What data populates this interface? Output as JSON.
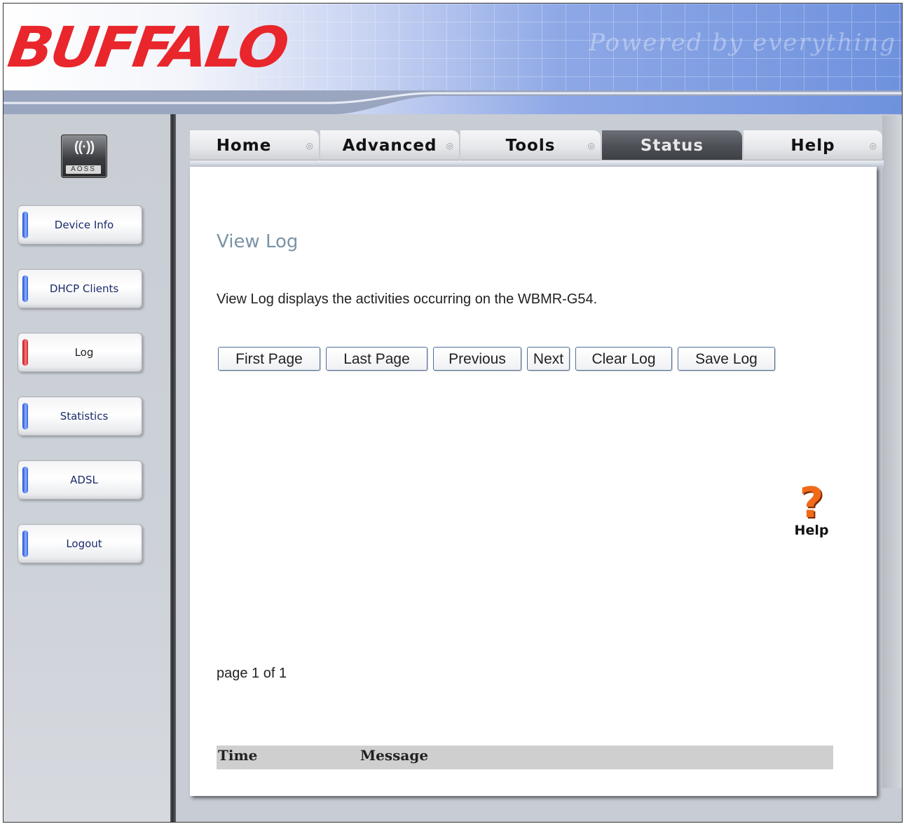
{
  "brand": {
    "logo": "BUFFALO",
    "watermark": "Powered by everything"
  },
  "aoss": {
    "label": "AOSS",
    "waves": "((·))"
  },
  "sidebar": {
    "items": [
      {
        "label": "Device Info"
      },
      {
        "label": "DHCP Clients"
      },
      {
        "label": "Log",
        "active": true
      },
      {
        "label": "Statistics"
      },
      {
        "label": "ADSL"
      },
      {
        "label": "Logout"
      }
    ]
  },
  "tabs": [
    {
      "label": "Home"
    },
    {
      "label": "Advanced"
    },
    {
      "label": "Tools"
    },
    {
      "label": "Status",
      "active": true
    },
    {
      "label": "Help"
    }
  ],
  "main": {
    "title": "View Log",
    "description": "View Log displays the activities occurring on the WBMR-G54.",
    "buttons": {
      "first": "First Page",
      "last": "Last Page",
      "previous": "Previous",
      "next": "Next",
      "clear": "Clear Log",
      "save": "Save Log"
    },
    "help": {
      "symbol": "?",
      "label": "Help"
    },
    "page_count": "page 1 of 1",
    "table": {
      "headers": [
        "Time",
        "Message"
      ]
    }
  },
  "colors": {
    "brand_red": "#e8262b",
    "active_tab": "#4c4f55",
    "title_blue_gray": "#7b93a6",
    "help_orange": "#f06a1a"
  }
}
